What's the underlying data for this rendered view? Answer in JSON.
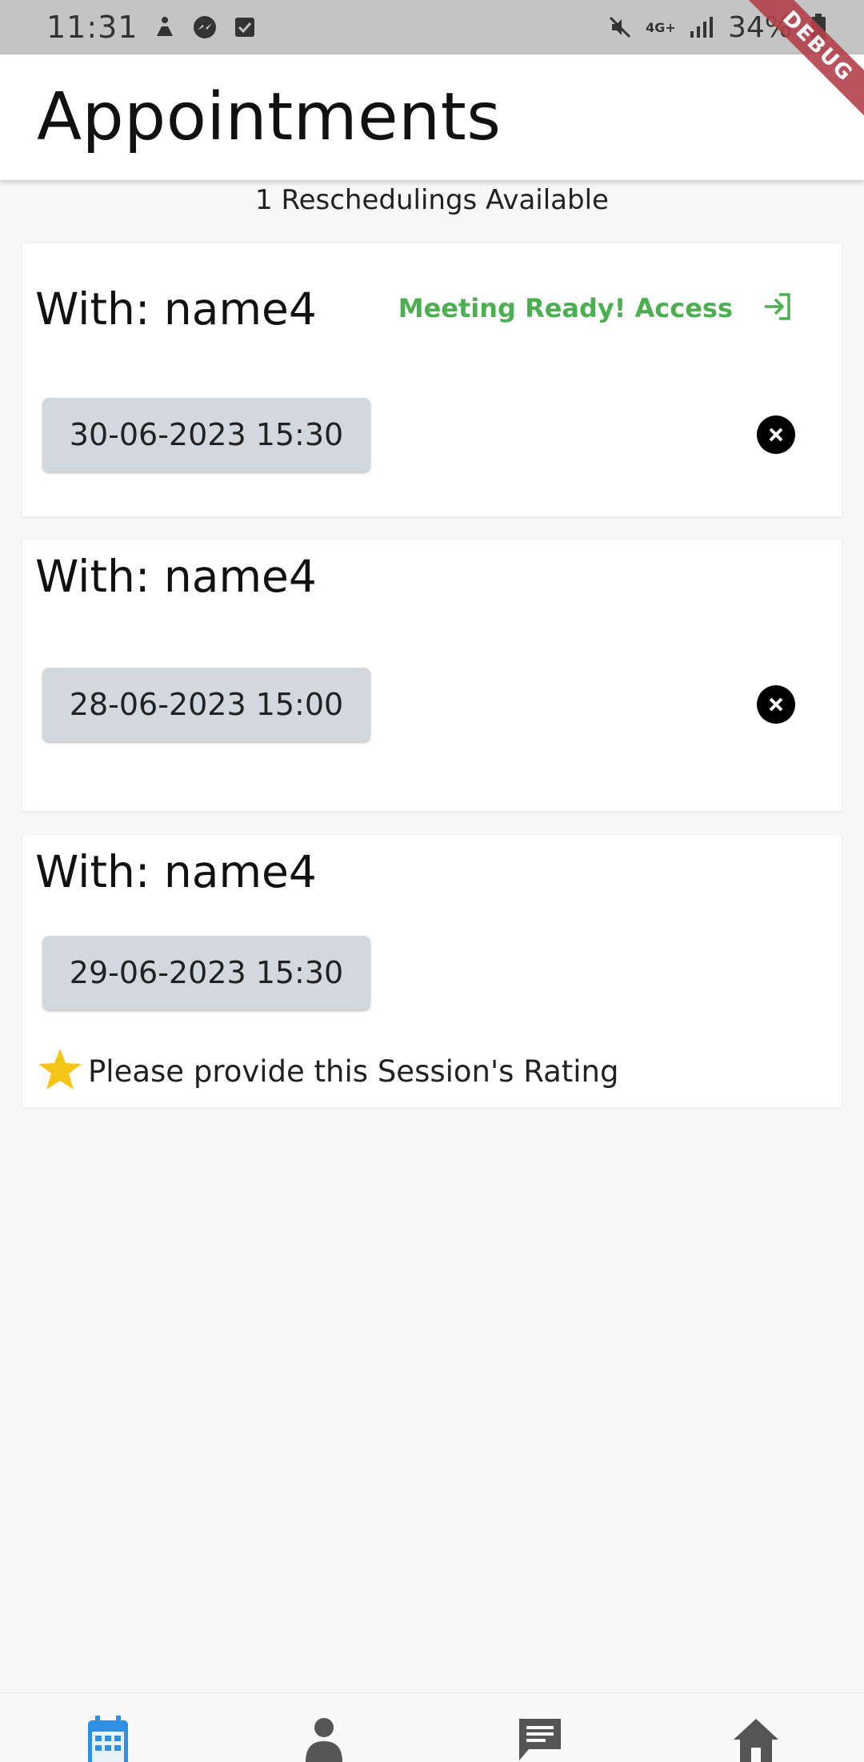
{
  "status_bar": {
    "time": "11:31",
    "network": "4G+",
    "battery": "34%"
  },
  "debug_label": "DEBUG",
  "header": {
    "title": "Appointments"
  },
  "reschedulings_text": "1 Reschedulings Available",
  "appointments": [
    {
      "with": "With: name4",
      "datetime": "30-06-2023 15:30",
      "meeting_label": "Meeting Ready! Access"
    },
    {
      "with": "With: name4",
      "datetime": "28-06-2023 15:00"
    },
    {
      "with": "With: name4",
      "datetime": "29-06-2023 15:30",
      "rating_prompt": "Please provide this Session's Rating"
    }
  ],
  "colors": {
    "accent_green": "#4caf50",
    "nav_active": "#2f8fe0",
    "nav_inactive": "#555555",
    "star": "#f5c518",
    "chip_bg": "#d1d9de"
  },
  "bottom_nav": {
    "items": [
      {
        "icon": "calendar-icon",
        "active": true
      },
      {
        "icon": "person-icon",
        "active": false
      },
      {
        "icon": "chat-icon",
        "active": false
      },
      {
        "icon": "home-icon",
        "active": false
      }
    ]
  }
}
